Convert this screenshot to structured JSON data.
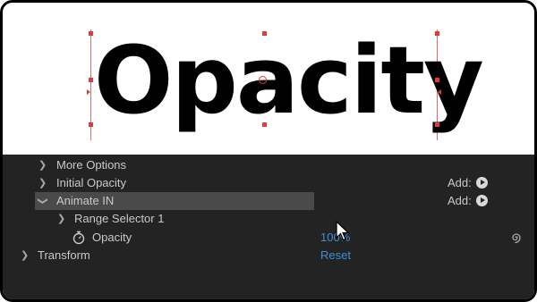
{
  "preview": {
    "text": "Opacity"
  },
  "layers": {
    "more_options": "More Options",
    "initial_opacity": "Initial Opacity",
    "animate_in": "Animate IN",
    "range_selector": "Range Selector 1",
    "opacity": "Opacity",
    "opacity_value": "100%",
    "transform": "Transform",
    "reset": "Reset",
    "add_label": "Add:"
  },
  "colors": {
    "panel_bg": "#232323",
    "link_blue": "#3e8ede",
    "selection_bg": "#4a4a4a",
    "guide_red": "#e03a3a"
  }
}
